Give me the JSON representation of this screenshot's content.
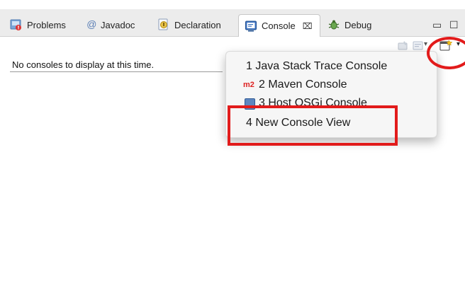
{
  "tabs": [
    {
      "label": "Problems",
      "icon": "problems-icon"
    },
    {
      "label": "Javadoc",
      "icon": "javadoc-icon",
      "glyph": "@"
    },
    {
      "label": "Declaration",
      "icon": "declaration-icon"
    },
    {
      "label": "Console",
      "icon": "console-icon",
      "active": true,
      "close_glyph": "⌧"
    },
    {
      "label": "Debug",
      "icon": "debug-icon"
    }
  ],
  "window_controls": {
    "minimize_glyph": "▭",
    "maximize_glyph": "☐"
  },
  "console": {
    "empty_message": "No consoles to display at this time."
  },
  "toolbar": {
    "pin_icon": "pin-console-icon",
    "display_selected_icon": "display-selected-console-icon",
    "open_console_icon": "open-console-icon",
    "dropdown_glyph": "▾"
  },
  "open_console_menu": {
    "items": [
      {
        "label": "1 Java Stack Trace Console"
      },
      {
        "label": "2 Maven Console",
        "badge": "m2"
      },
      {
        "label": "3 Host OSGi Console",
        "icon": "osgi-console-icon"
      },
      {
        "label": "4 New Console View"
      }
    ]
  },
  "annotations": {
    "highlight_color": "#e21b1b"
  },
  "colors": {
    "tabbar_bg": "#ececec",
    "menu_bg": "#f6f6f6",
    "m2_red": "#dd2222"
  }
}
